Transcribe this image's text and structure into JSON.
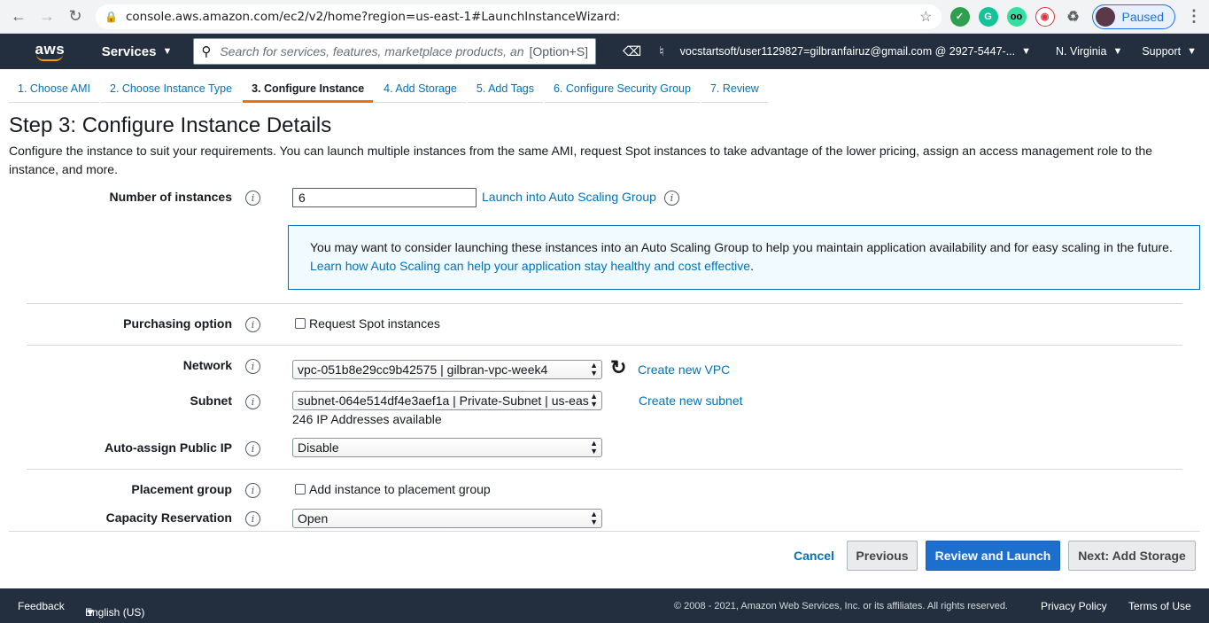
{
  "browser": {
    "url": "console.aws.amazon.com/ec2/v2/home?region=us-east-1#LaunchInstanceWizard:",
    "profile_status": "Paused"
  },
  "header": {
    "logo": "aws",
    "services_label": "Services",
    "search_placeholder": "Search for services, features, marketplace products, an",
    "search_shortcut": "[Option+S]",
    "account": "vocstartsoft/user1129827=gilbranfairuz@gmail.com @ 2927-5447-...",
    "region": "N. Virginia",
    "support": "Support"
  },
  "tabs": [
    {
      "label": "1. Choose AMI"
    },
    {
      "label": "2. Choose Instance Type"
    },
    {
      "label": "3. Configure Instance"
    },
    {
      "label": "4. Add Storage"
    },
    {
      "label": "5. Add Tags"
    },
    {
      "label": "6. Configure Security Group"
    },
    {
      "label": "7. Review"
    }
  ],
  "page": {
    "title": "Step 3: Configure Instance Details",
    "description": "Configure the instance to suit your requirements. You can launch multiple instances from the same AMI, request Spot instances to take advantage of the lower pricing, assign an access management role to the instance, and more."
  },
  "form": {
    "instances_label": "Number of instances",
    "instances_value": "6",
    "asg_link": "Launch into Auto Scaling Group",
    "asg_notice": "You may want to consider launching these instances into an Auto Scaling Group to help you maintain application availability and for easy scaling in the future.",
    "asg_notice_link": "Learn how Auto Scaling can help your application stay healthy and cost effective",
    "purchasing_label": "Purchasing option",
    "spot_label": "Request Spot instances",
    "network_label": "Network",
    "network_value": "vpc-051b8e29cc9b42575 | gilbran-vpc-week4",
    "create_vpc": "Create new VPC",
    "subnet_label": "Subnet",
    "subnet_value": "subnet-064e514df4e3aef1a | Private-Subnet | us-eas",
    "subnet_note": "246 IP Addresses available",
    "create_subnet": "Create new subnet",
    "public_ip_label": "Auto-assign Public IP",
    "public_ip_value": "Disable",
    "placement_label": "Placement group",
    "placement_check": "Add instance to placement group",
    "capacity_label": "Capacity Reservation",
    "capacity_value": "Open"
  },
  "buttons": {
    "cancel": "Cancel",
    "previous": "Previous",
    "review_launch": "Review and Launch",
    "next": "Next: Add Storage"
  },
  "footer": {
    "feedback": "Feedback",
    "language": "English (US)",
    "copyright": "© 2008 - 2021, Amazon Web Services, Inc. or its affiliates. All rights reserved.",
    "privacy": "Privacy Policy",
    "terms": "Terms of Use"
  },
  "colors": {
    "aws_header": "#232f3e",
    "accent_orange": "#ec7211",
    "link_blue": "#0073bb",
    "primary_button": "#1d6fce"
  }
}
